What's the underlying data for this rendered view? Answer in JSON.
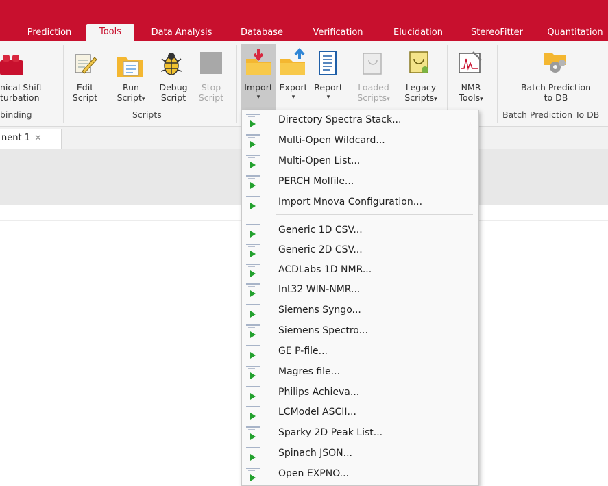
{
  "tabs": [
    {
      "label": "Prediction",
      "active": false
    },
    {
      "label": "Tools",
      "active": true
    },
    {
      "label": "Data Analysis",
      "active": false
    },
    {
      "label": "Database",
      "active": false
    },
    {
      "label": "Verification",
      "active": false
    },
    {
      "label": "Elucidation",
      "active": false
    },
    {
      "label": "StereoFitter",
      "active": false
    },
    {
      "label": "Quantitation",
      "active": false
    }
  ],
  "ribbon": {
    "chemical_shift": {
      "line1": "nical Shift",
      "line2": "turbation",
      "line3": "binding"
    },
    "edit_script": {
      "line1": "Edit",
      "line2": "Script"
    },
    "run_script": {
      "line1": "Run",
      "line2": "Script"
    },
    "debug_script": {
      "line1": "Debug",
      "line2": "Script"
    },
    "stop_script": {
      "line1": "Stop",
      "line2": "Script"
    },
    "scripts_group": "Scripts",
    "import": {
      "line1": "Import"
    },
    "export": {
      "line1": "Export"
    },
    "report": {
      "line1": "Report"
    },
    "loaded_scripts": {
      "line1": "Loaded",
      "line2": "Scripts"
    },
    "legacy_scripts": {
      "line1": "Legacy",
      "line2": "Scripts"
    },
    "nmr_tools": {
      "line1": "NMR",
      "line2": "Tools"
    },
    "batch_prediction": {
      "line1": "Batch Prediction",
      "line2": "to DB"
    },
    "batch_group": "Batch Prediction To DB",
    "arrow": "▾"
  },
  "document_tab": {
    "label": "nent 1",
    "close": "×"
  },
  "import_menu": {
    "group1": [
      "Directory Spectra Stack...",
      "Multi-Open Wildcard...",
      "Multi-Open List...",
      "PERCH Molfile...",
      "Import Mnova Configuration..."
    ],
    "group2": [
      "Generic 1D CSV...",
      "Generic 2D CSV...",
      "ACDLabs 1D NMR...",
      "Int32 WIN-NMR...",
      "Siemens Syngo...",
      "Siemens Spectro...",
      "GE P-file...",
      "Magres file...",
      "Philips Achieva...",
      "LCModel ASCII...",
      "Sparky 2D Peak List...",
      "Spinach JSON...",
      "Open EXPNO..."
    ]
  },
  "colors": {
    "brand": "#c8102e",
    "menu_icon": "#23a12e",
    "folder": "#f4b731"
  }
}
